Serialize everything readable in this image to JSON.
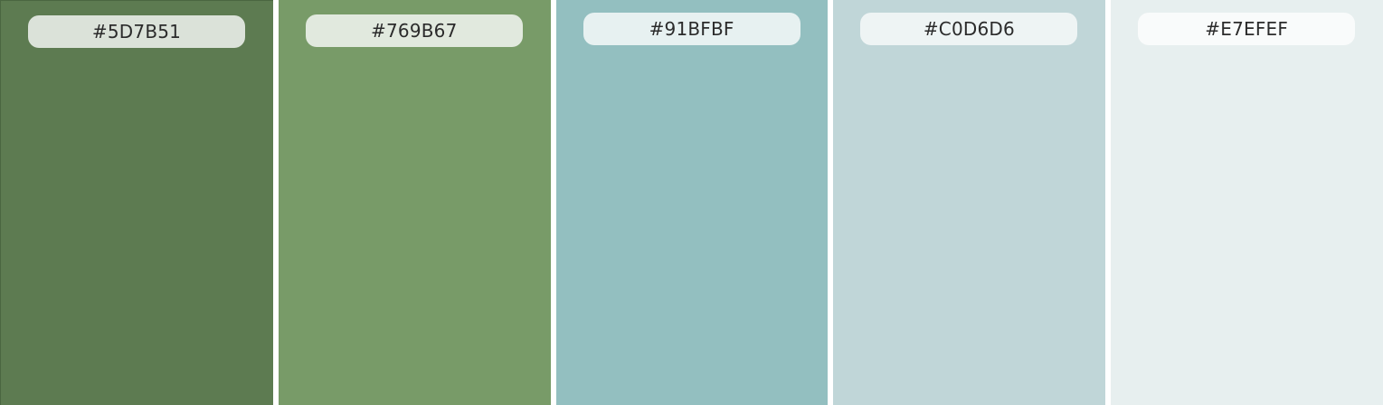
{
  "swatches": [
    {
      "hex": "#5D7B51",
      "color": "#5D7B51",
      "pill_bg": "rgba(255,255,255,0.78)"
    },
    {
      "hex": "#769B67",
      "color": "#789B68",
      "pill_bg": "rgba(255,255,255,0.78)"
    },
    {
      "hex": "#91BFBF",
      "color": "#93BFC0",
      "pill_bg": "rgba(255,255,255,0.78)"
    },
    {
      "hex": "#C0D6D6",
      "color": "#C0D6D8",
      "pill_bg": "rgba(255,255,255,0.72)"
    },
    {
      "hex": "#E7EFEF",
      "color": "#E7EFEF",
      "pill_bg": "rgba(255,255,255,0.75)"
    }
  ]
}
